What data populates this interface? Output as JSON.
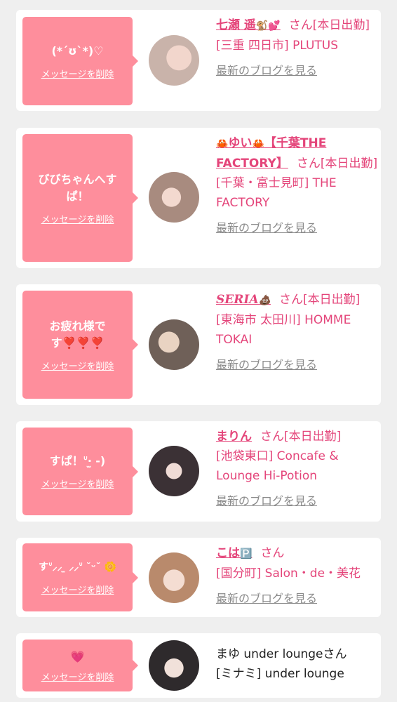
{
  "cards": [
    {
      "message": "(*´ʊ`*)♡",
      "delete_label": "メッセージを削除",
      "name": "七瀬 遥",
      "name_emoji": "🐒💕",
      "san": "さん[本日出勤]",
      "location": "[三重 四日市] PLUTUS",
      "blog_label": "最新のブログを見る"
    },
    {
      "message": "びびちゃんへすぱ！",
      "delete_label": "メッセージを削除",
      "name_prefix_emoji": "🦀",
      "name": "ゆい",
      "name_suffix_emoji": "🦀",
      "name_rest": "【千葉THE FACTORY】",
      "san": "さん[本日出勤]",
      "location": "[千葉・富士見町] THE FACTORY",
      "blog_label": "最新のブログを見る"
    },
    {
      "message": "お疲れ様です❣️❣️❣️",
      "delete_label": "メッセージを削除",
      "name": "SERIA",
      "name_emoji": "💩",
      "san": "さん[本日出勤]",
      "location": "[東海市 太田川] HOMME TOKAI",
      "blog_label": "最新のブログを見る"
    },
    {
      "message": "すぱ！ᐡ‧̫ -)",
      "delete_label": "メッセージを削除",
      "name": "まりん",
      "san": "さん[本日出勤]",
      "location": "[池袋東口] Concafe & Lounge Hi-Potion",
      "blog_label": "最新のブログを見る"
    },
    {
      "message": "すᐡ⸝⸝ ̫ ⸝⸝ᐡ ˘ᵕ˘ 🌼",
      "delete_label": "メッセージを削除",
      "name": "こは",
      "name_emoji": "🅿️",
      "san": "さん",
      "location": "[国分町] Salon・de・美花",
      "blog_label": "最新のブログを見る"
    },
    {
      "message": "💗",
      "delete_label": "メッセージを削除",
      "name_line": "まゆ under loungeさん",
      "location": "[ミナミ] under lounge"
    }
  ]
}
